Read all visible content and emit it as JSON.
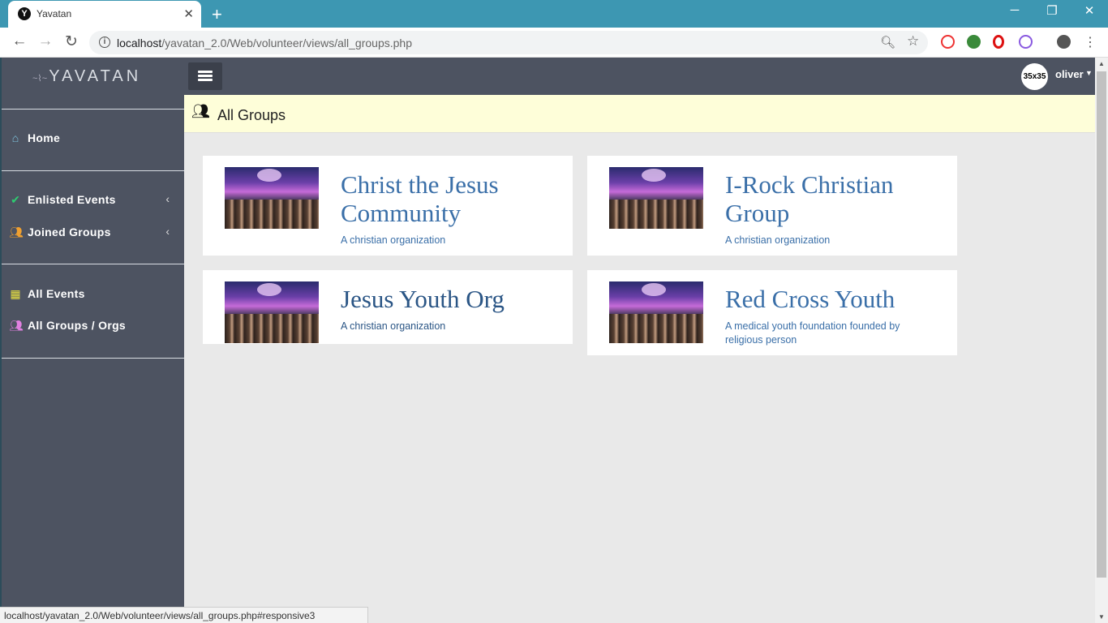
{
  "browser": {
    "tab_title": "Yavatan",
    "tab_favicon": "Y",
    "url_host": "localhost",
    "url_path": "/yavatan_2.0/Web/volunteer/views/all_groups.php",
    "status_url": "localhost/yavatan_2.0/Web/volunteer/views/all_groups.php#responsive3"
  },
  "app": {
    "logo": "YAVATAN"
  },
  "sidebar": {
    "items": [
      {
        "label": "Home",
        "icon": "home-icon",
        "color": "#7fc4e0"
      },
      {
        "label": "Enlisted Events",
        "icon": "check-icon",
        "color": "#2ecc71"
      },
      {
        "label": "Joined Groups",
        "icon": "groups-icon",
        "color": "#f0a030"
      },
      {
        "label": "All Events",
        "icon": "calendar-icon",
        "color": "#e8e040"
      },
      {
        "label": "All Groups / Orgs",
        "icon": "groups-icon",
        "color": "#e080e0"
      }
    ]
  },
  "topbar": {
    "avatar_text": "35x35",
    "username": "oliver"
  },
  "page": {
    "title": "All Groups"
  },
  "groups": [
    {
      "title": "Christ the Jesus Community",
      "description": "A christian organization"
    },
    {
      "title": "I-Rock Christian Group",
      "description": "A christian organization"
    },
    {
      "title": "Jesus Youth Org",
      "description": "A christian organization"
    },
    {
      "title": "Red Cross Youth",
      "description": "A medical youth foundation founded by religious person"
    }
  ]
}
